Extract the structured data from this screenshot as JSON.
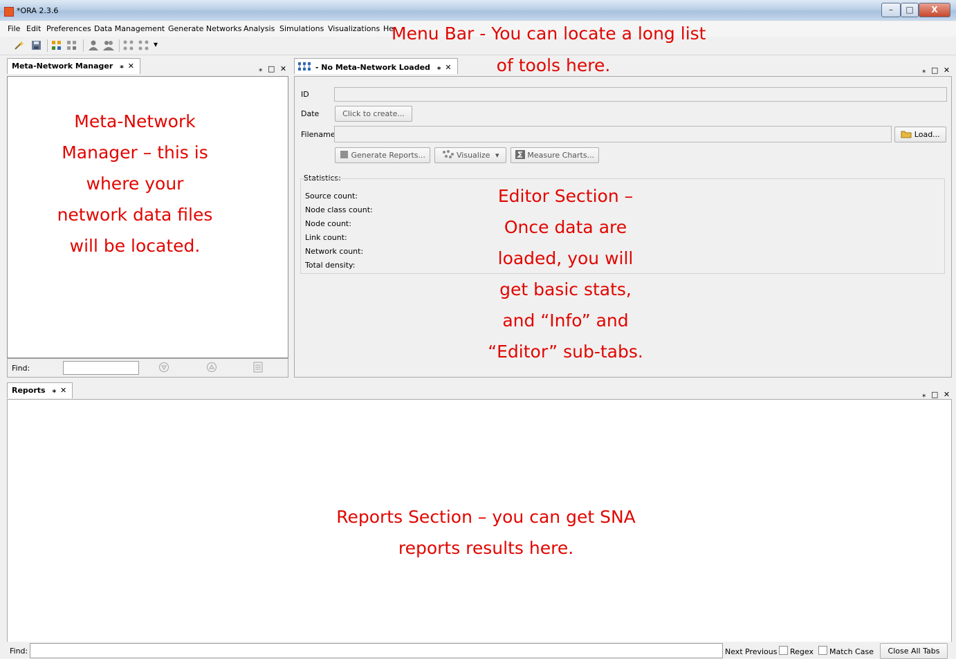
{
  "window": {
    "title": "*ORA 2.3.6",
    "minimize_glyph": "–",
    "maximize_glyph": "□",
    "close_glyph": "X"
  },
  "menu": [
    "File",
    "Edit",
    "Preferences",
    "Data Management",
    "Generate Networks",
    "Analysis",
    "Simulations",
    "Visualizations",
    "He"
  ],
  "toolbar": {
    "icons": [
      "wand-icon",
      "save-icon",
      "network-icon",
      "network-grid-icon",
      "agent-icon",
      "agents-icon",
      "nodes-icon",
      "nodes-dropdown-icon"
    ],
    "dropdown_glyph": "▾"
  },
  "meta_manager": {
    "tab_label": "Meta-Network Manager",
    "pin_glyph": "⁎",
    "close_glyph": "✕",
    "find_label": "Find:"
  },
  "editor": {
    "tab_label": "No Meta-Network Loaded",
    "id_label": "ID",
    "id_value": "",
    "date_label": "Date",
    "date_button": "Click to create...",
    "filename_label": "Filename",
    "filename_value": "",
    "load_button": "Load...",
    "generate_reports_button": "Generate Reports...",
    "visualize_button": "Visualize",
    "measure_charts_button": "Measure Charts...",
    "statistics_label": "Statistics:",
    "stats": [
      "Source count:",
      "Node class count:",
      "Node count:",
      "Link count:",
      "Network count:",
      "Total density:"
    ]
  },
  "reports": {
    "tab_label": "Reports",
    "find_label": "Find:",
    "find_value": "",
    "next": "Next",
    "previous": "Previous",
    "regex": "Regex",
    "match_case": "Match Case",
    "close_all": "Close All Tabs"
  },
  "panel_controls": "⁎ □ ✕",
  "annotations": {
    "menu_bar": [
      "Menu Bar - You can locate a long list",
      "of tools here."
    ],
    "meta_manager": [
      "Meta-Network",
      "Manager – this is",
      "where your",
      "network data files",
      "will be located."
    ],
    "editor": [
      "Editor Section –",
      "Once data are",
      "loaded, you will",
      "get basic stats,",
      "and “Info” and",
      "“Editor” sub-tabs."
    ],
    "reports": [
      "Reports Section – you can get SNA",
      "reports results here."
    ]
  },
  "colors": {
    "annotation_red": "#e10600",
    "panel_bg": "#f0f0f0"
  }
}
